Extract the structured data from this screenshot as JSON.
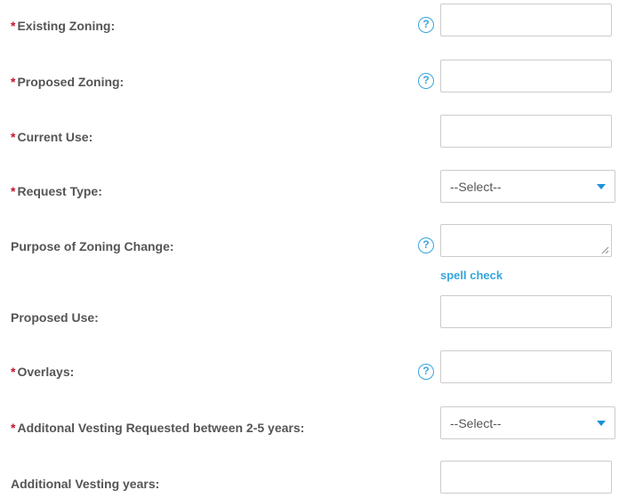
{
  "form": {
    "required_marker": "*",
    "help_glyph": "?",
    "spell_check_label": "spell check",
    "fields": [
      {
        "label": "Existing Zoning:",
        "required": true,
        "help_icon": true,
        "control": "text",
        "value": ""
      },
      {
        "label": "Proposed Zoning:",
        "required": true,
        "help_icon": true,
        "control": "text",
        "value": ""
      },
      {
        "label": "Current Use:",
        "required": true,
        "help_icon": false,
        "control": "text",
        "value": ""
      },
      {
        "label": "Request Type:",
        "required": true,
        "help_icon": false,
        "control": "select",
        "selected": "--Select--"
      },
      {
        "label": "Purpose of Zoning Change:",
        "required": false,
        "help_icon": true,
        "control": "textarea",
        "value": ""
      },
      {
        "label": "Proposed Use:",
        "required": false,
        "help_icon": false,
        "control": "text",
        "value": ""
      },
      {
        "label": "Overlays:",
        "required": true,
        "help_icon": true,
        "control": "text",
        "value": ""
      },
      {
        "label": "Additonal Vesting Requested between 2-5 years:",
        "required": true,
        "help_icon": false,
        "control": "select",
        "selected": "--Select--"
      },
      {
        "label": "Additional Vesting years:",
        "required": false,
        "help_icon": false,
        "control": "text",
        "value": ""
      }
    ]
  },
  "colors": {
    "required": "#c8102e",
    "label": "#555555",
    "accent": "#35a6de",
    "caret": "#1a90d9",
    "border": "#cccccc"
  },
  "icons": {
    "help": "question-circle-icon",
    "dropdown": "caret-down-icon",
    "resize": "resize-grip-icon"
  }
}
